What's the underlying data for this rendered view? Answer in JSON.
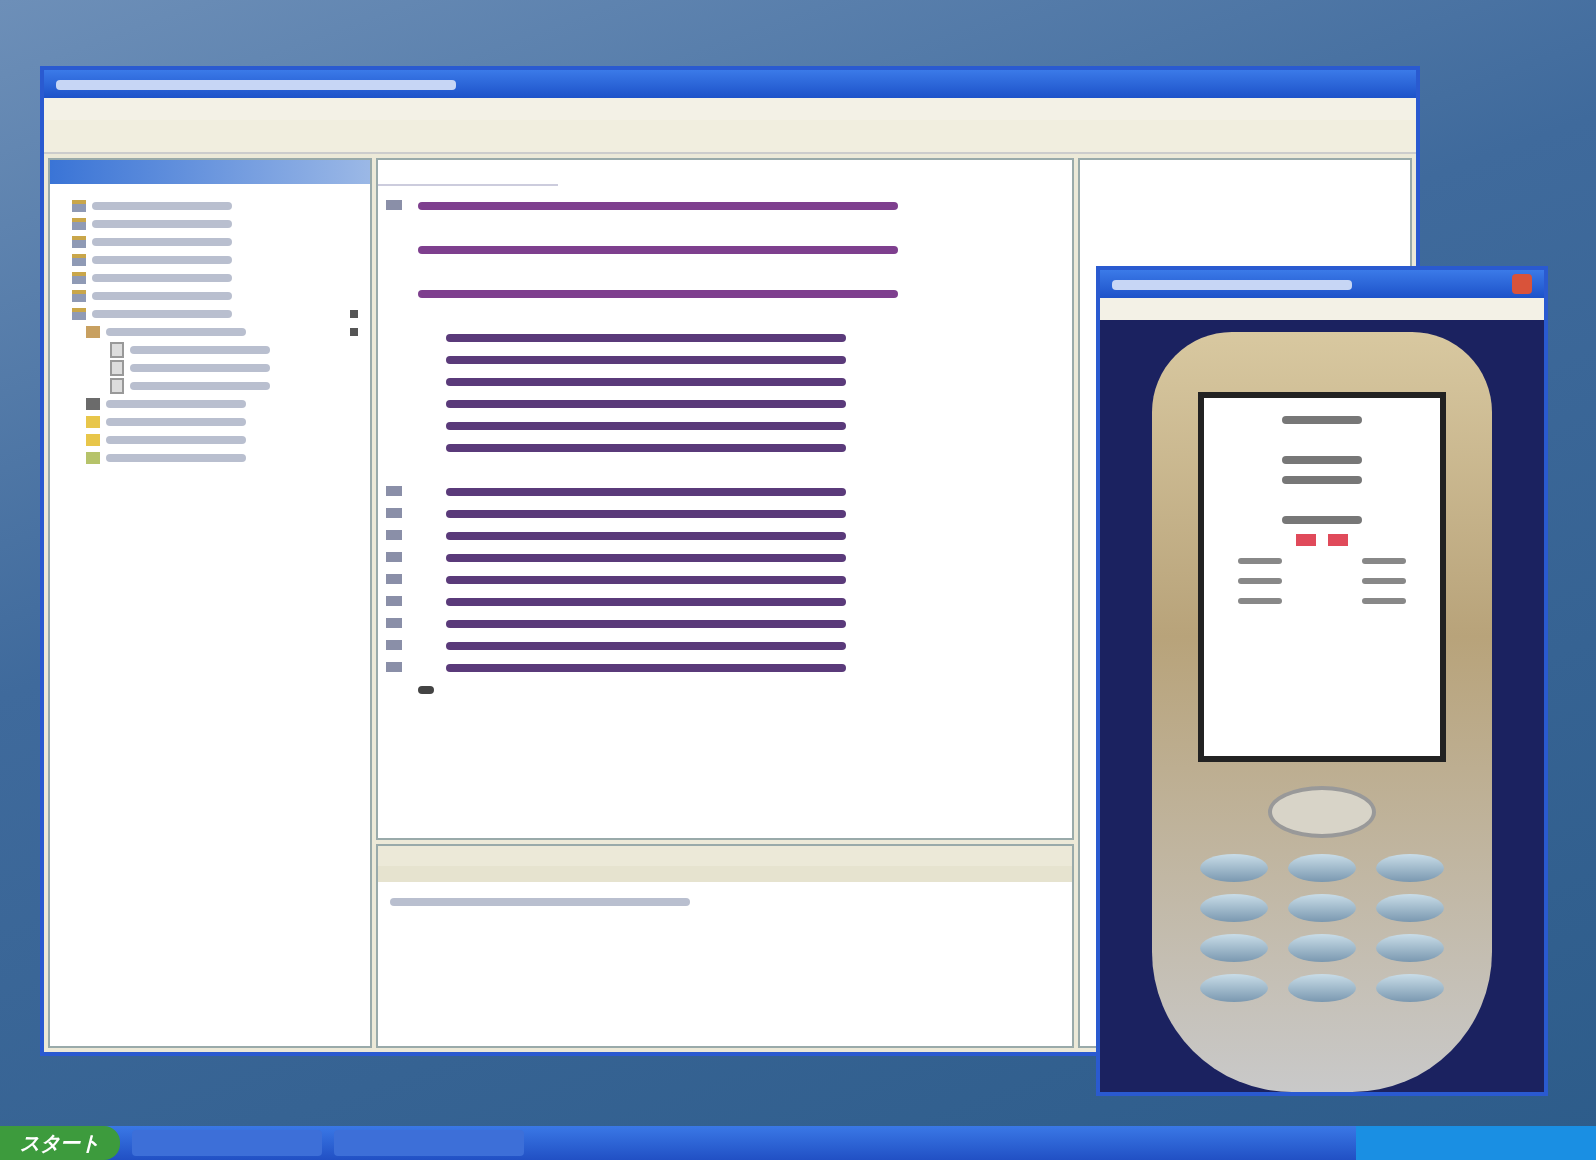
{
  "eclipse": {
    "tree": [
      {
        "kind": "project",
        "expanded": false
      },
      {
        "kind": "project",
        "expanded": false
      },
      {
        "kind": "project",
        "expanded": false
      },
      {
        "kind": "project",
        "expanded": false
      },
      {
        "kind": "project",
        "expanded": false
      },
      {
        "kind": "project",
        "expanded": false
      },
      {
        "kind": "project",
        "expanded": true,
        "children": [
          {
            "kind": "package",
            "expanded": true,
            "children": [
              {
                "kind": "file",
                "expanded": false
              },
              {
                "kind": "file",
                "expanded": false
              },
              {
                "kind": "file",
                "expanded": false
              }
            ]
          },
          {
            "kind": "library",
            "expanded": false
          },
          {
            "kind": "folder",
            "expanded": false
          },
          {
            "kind": "folder",
            "expanded": false
          },
          {
            "kind": "jad",
            "expanded": false
          }
        ]
      }
    ],
    "code": [
      {
        "kind": "top",
        "marker": true
      },
      {
        "kind": "blank",
        "marker": false
      },
      {
        "kind": "top",
        "marker": false
      },
      {
        "kind": "blank",
        "marker": false
      },
      {
        "kind": "top",
        "marker": false
      },
      {
        "kind": "blank",
        "marker": false
      },
      {
        "kind": "member",
        "marker": false
      },
      {
        "kind": "member",
        "marker": false
      },
      {
        "kind": "member",
        "marker": false
      },
      {
        "kind": "member",
        "marker": false
      },
      {
        "kind": "member",
        "marker": false
      },
      {
        "kind": "member",
        "marker": false
      },
      {
        "kind": "blank",
        "marker": false
      },
      {
        "kind": "member",
        "marker": true
      },
      {
        "kind": "member",
        "marker": true
      },
      {
        "kind": "member",
        "marker": true
      },
      {
        "kind": "member",
        "marker": true
      },
      {
        "kind": "member",
        "marker": true
      },
      {
        "kind": "member",
        "marker": true
      },
      {
        "kind": "member",
        "marker": true
      },
      {
        "kind": "member",
        "marker": true
      },
      {
        "kind": "member",
        "marker": true
      },
      {
        "kind": "close",
        "marker": false
      }
    ]
  },
  "phone": {
    "screen": [
      {
        "kind": "center"
      },
      {
        "kind": "blank"
      },
      {
        "kind": "center"
      },
      {
        "kind": "center"
      },
      {
        "kind": "blank"
      },
      {
        "kind": "center"
      },
      {
        "kind": "buttons"
      },
      {
        "kind": "pair"
      },
      {
        "kind": "pair"
      },
      {
        "kind": "pair"
      }
    ]
  },
  "taskbar": {
    "start": "スタート"
  }
}
